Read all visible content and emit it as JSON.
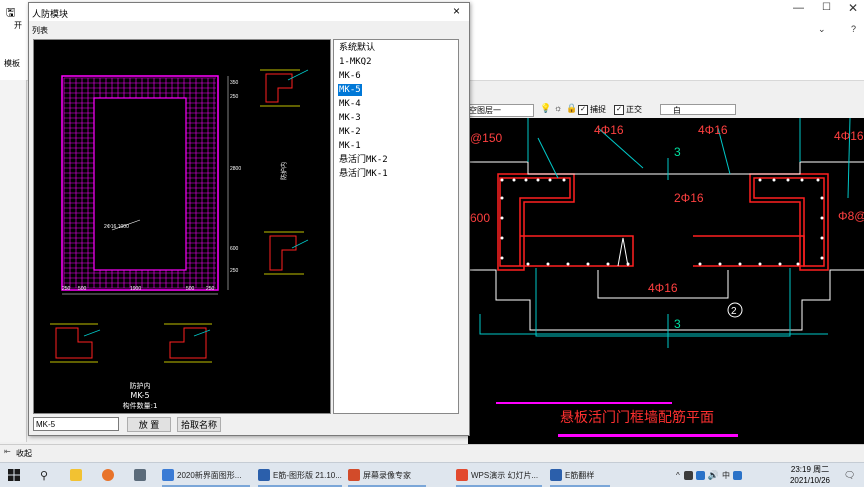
{
  "app": {
    "toolbar_label": "开",
    "left_tab": "模板",
    "layer_select": "空图层一",
    "snap_label": "捕捉",
    "ortho_label": "正交",
    "color_select": "白",
    "status_text": "收起"
  },
  "dialog": {
    "title": "人防模块",
    "menu_label": "列表",
    "close_label": "×",
    "list_items": [
      "系统默认",
      "1-MKQ2",
      "MK-6",
      "MK-5",
      "MK-4",
      "MK-3",
      "MK-2",
      "MK-1",
      "悬活门MK-2",
      "悬活门MK-1"
    ],
    "selected_index": 3,
    "name_value": "MK-5",
    "place_button": "放 置",
    "pick_name_button": "拾取名称"
  },
  "preview_drawing": {
    "dims_top": [
      "250",
      "500",
      "1900",
      "500",
      "250"
    ],
    "dims_right": [
      "350",
      "250",
      "2800",
      "600",
      "250"
    ],
    "label_rebar": "2Φ16,1000",
    "side_label": "防护内",
    "caption_line1": "防护内",
    "caption_line2": "MK-5",
    "caption_line3": "构件数量:1"
  },
  "cad": {
    "labels": [
      "4Φ16",
      "4Φ16",
      "4Φ16",
      "2Φ16",
      "4Φ16",
      "@150",
      "600",
      "Φ8@",
      "3",
      "3",
      "2"
    ],
    "title": "悬板活门门框墙配筋平面"
  },
  "taskbar": {
    "items": [
      "2020新界面图形...",
      "E筋-图形版 21.10...",
      "屏幕录像专家",
      "WPS演示 幻灯片...",
      "E筋翻样"
    ],
    "clock_time": "23:19 周二",
    "clock_date": "2021/10/26"
  },
  "colors": {
    "accent": "#0078d7",
    "magenta": "#ff00ff",
    "red": "#ff2020",
    "cyan": "#00c8c8"
  }
}
